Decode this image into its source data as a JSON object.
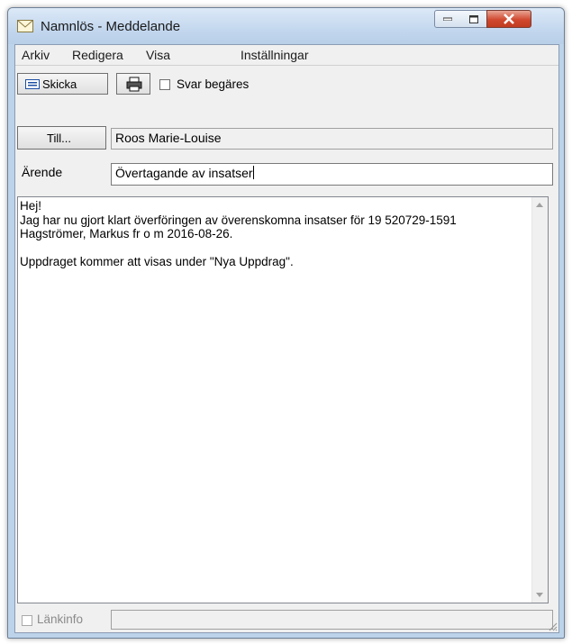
{
  "window": {
    "title": "Namnlös - Meddelande",
    "icon": "envelope-icon",
    "controls": [
      "minimize-icon",
      "maximize-icon",
      "close-icon"
    ]
  },
  "menu": [
    "Arkiv",
    "Redigera",
    "Visa",
    "Inställningar"
  ],
  "toolbar": {
    "send_label": "Skicka",
    "send_icon": "send-icon",
    "print_icon": "printer-icon",
    "reply_request_label": "Svar begäres",
    "reply_request_checked": false
  },
  "to": {
    "button_label": "Till...",
    "value": "Roos Marie-Louise"
  },
  "subject": {
    "label": "Ärende",
    "value": "Övertagande av insatser"
  },
  "message": {
    "body": "Hej!\nJag har nu gjort klart överföringen av överenskomna insatser för 19 520729-1591\nHagströmer, Markus fr o m 2016-08-26.\n\nUppdraget kommer att visas under \"Nya Uppdrag\"."
  },
  "footer": {
    "link_info_label": "Länkinfo",
    "link_info_checked": false,
    "link_info_value": ""
  },
  "colors": {
    "frame": "#bcd3ea",
    "client": "#f0f0f0",
    "close_button": "#c84a2f"
  }
}
